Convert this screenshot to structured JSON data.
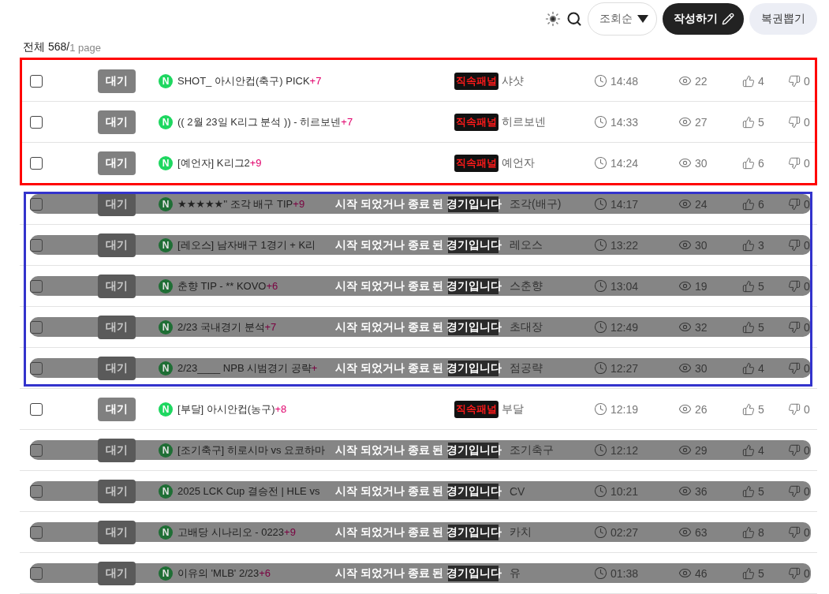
{
  "toolbar": {
    "sort": "조회순",
    "write_button": "작성하기",
    "lottery_button": "복권뽑기"
  },
  "summary": {
    "label": "전체 568/",
    "page": "1 page"
  },
  "groups": [
    {
      "color": "#ff0000",
      "rows": [
        {
          "checked": false,
          "status": "대기",
          "mark": "N",
          "title": "SHOT_ 아시안컵(축구) PICK",
          "count": "+7",
          "badge": "직속패널",
          "author": "샤샷",
          "time": "14:48",
          "views": "22",
          "likes": "4",
          "dislikes": "0",
          "closed": false
        },
        {
          "checked": false,
          "status": "대기",
          "mark": "N",
          "title": "(( 2월 23일 K리그 분석 )) - 히르보넨",
          "count": "+7",
          "badge": "직속패널",
          "author": "히르보넨",
          "time": "14:33",
          "views": "27",
          "likes": "5",
          "dislikes": "0",
          "closed": false
        },
        {
          "checked": false,
          "status": "대기",
          "mark": "N",
          "title": "[예언자] K리그2",
          "count": "+9",
          "badge": "직속패널",
          "author": "예언자",
          "time": "14:24",
          "views": "30",
          "likes": "6",
          "dislikes": "0",
          "closed": false
        }
      ]
    },
    {
      "color": "#3333cc",
      "rows": [
        {
          "checked": false,
          "status": "대기",
          "mark": "N",
          "title": "★★★★★'' 조각 배구 TIP",
          "count": "+9",
          "author": "조각(배구)",
          "time": "14:17",
          "views": "24",
          "likes": "6",
          "dislikes": "0",
          "closed": true,
          "notice": "시작 되었거나 종료 된 경기입니다"
        },
        {
          "checked": false,
          "status": "대기",
          "mark": "N",
          "title": "[레오스] 남자배구 1경기 + K리",
          "author": "레오스",
          "time": "13:22",
          "views": "30",
          "likes": "3",
          "dislikes": "0",
          "closed": true,
          "notice": "시작 되었거나 종료 된 경기입니다"
        },
        {
          "checked": false,
          "status": "대기",
          "mark": "N",
          "title": "춘향 TIP - ** KOVO",
          "count": "+6",
          "author": "스춘향",
          "time": "13:04",
          "views": "19",
          "likes": "5",
          "dislikes": "0",
          "closed": true,
          "notice": "시작 되었거나 종료 된 경기입니다"
        },
        {
          "checked": false,
          "status": "대기",
          "mark": "N",
          "title": "2/23 국내경기 분석",
          "count": "+7",
          "author": "초대장",
          "time": "12:49",
          "views": "32",
          "likes": "5",
          "dislikes": "0",
          "closed": true,
          "notice": "시작 되었거나 종료 된 경기입니다"
        },
        {
          "checked": false,
          "status": "대기",
          "mark": "N",
          "title": "2/23____ NPB 시범경기 공략",
          "count": "+",
          "author": "점공략",
          "time": "12:27",
          "views": "30",
          "likes": "4",
          "dislikes": "0",
          "closed": true,
          "notice": "시작 되었거나 종료 된 경기입니다"
        }
      ]
    },
    {
      "rows": [
        {
          "checked": false,
          "status": "대기",
          "mark": "N",
          "title": "[부달] 아시안컵(농구)",
          "count": "+8",
          "badge": "직속패널",
          "author": "부달",
          "time": "12:19",
          "views": "26",
          "likes": "5",
          "dislikes": "0",
          "closed": false
        },
        {
          "checked": false,
          "status": "대기",
          "mark": "N",
          "title": "[조기축구] 히로시마 vs 요코하마",
          "author": "조기축구",
          "time": "12:12",
          "views": "29",
          "likes": "4",
          "dislikes": "0",
          "closed": true,
          "notice": "시작 되었거나 종료 된 경기입니다"
        },
        {
          "checked": false,
          "status": "대기",
          "mark": "N",
          "title": "2025 LCK Cup 결승전 | HLE vs",
          "author": "CV",
          "time": "10:21",
          "views": "36",
          "likes": "5",
          "dislikes": "0",
          "closed": true,
          "notice": "시작 되었거나 종료 된 경기입니다"
        },
        {
          "checked": false,
          "status": "대기",
          "mark": "N",
          "title": "고배당 시나리오 - 0223",
          "count": "+9",
          "author": "카치",
          "time": "02:27",
          "views": "63",
          "likes": "8",
          "dislikes": "0",
          "closed": true,
          "notice": "시작 되었거나 종료 된 경기입니다"
        },
        {
          "checked": false,
          "status": "대기",
          "mark": "N",
          "title": "이유의 'MLB' 2/23",
          "count": "+6",
          "author": "유",
          "time": "01:38",
          "views": "46",
          "likes": "5",
          "dislikes": "0",
          "closed": true,
          "notice": "시작 되었거나 종료 된 경기입니다"
        }
      ]
    }
  ]
}
